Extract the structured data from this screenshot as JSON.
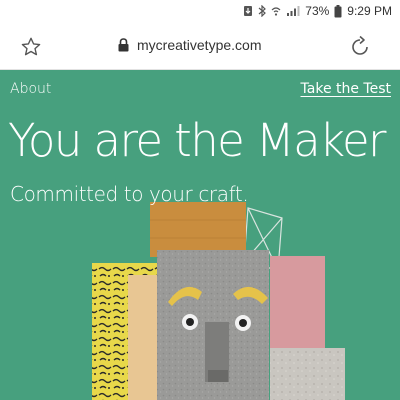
{
  "status_bar": {
    "battery_percent": "73%",
    "time": "9:29 PM",
    "icons": [
      "download-icon",
      "bluetooth-icon",
      "wifi-icon",
      "signal-icon",
      "battery-icon"
    ]
  },
  "browser": {
    "url": "mycreativetype.com",
    "icons": [
      "star-icon",
      "lock-icon",
      "reload-icon"
    ]
  },
  "page": {
    "nav": {
      "about": "About",
      "take_test": "Take the Test"
    },
    "title": "You are the Maker",
    "subtitle": "Committed to your craft.",
    "colors": {
      "background": "#47a07e",
      "text": "#ffffff"
    }
  }
}
